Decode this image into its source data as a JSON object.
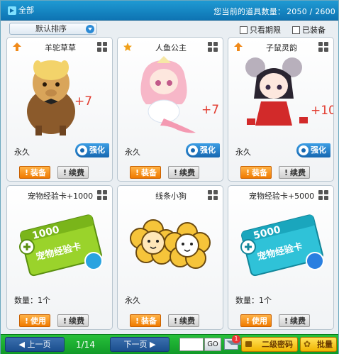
{
  "header": {
    "tab_label": "全部",
    "count_label": "您当前的道具数量：",
    "count_value": "2050 / 2600"
  },
  "filters": {
    "sort_selected": "默认排序",
    "only_expiring": "只看期限",
    "equipped": "已装备"
  },
  "items": [
    {
      "name": "羊驼草草",
      "plus": "+7",
      "duration": "永久",
      "enhance_label": "强化",
      "primary": "装备",
      "secondary": "续费",
      "corner": "up-arrow-icon"
    },
    {
      "name": "人鱼公主",
      "plus": "+7",
      "duration": "永久",
      "enhance_label": "强化",
      "primary": "装备",
      "secondary": "续费",
      "corner": "star-icon"
    },
    {
      "name": "子鼠灵韵",
      "plus": "+10",
      "duration": "永久",
      "enhance_label": "强化",
      "primary": "装备",
      "secondary": "续费",
      "corner": "up-arrow-icon"
    },
    {
      "name": "宠物经验卡+1000",
      "duration": "数量：1个",
      "primary": "使用",
      "secondary": "续费"
    },
    {
      "name": "线条小狗",
      "duration": "永久",
      "primary": "装备",
      "secondary": "续费"
    },
    {
      "name": "宠物经验卡+5000",
      "duration": "数量：1个",
      "primary": "使用",
      "secondary": "续费"
    }
  ],
  "card_art": {
    "exp_1000": "1000",
    "exp_5000": "5000",
    "exp_card_text": "宠物经验卡"
  },
  "footer": {
    "prev_label": "上一页",
    "page_info": "1/14",
    "next_label": "下一页",
    "go_label": "GO",
    "mail_badge": "1",
    "password_label": "二级密码",
    "batch_label": "批量"
  },
  "colors": {
    "header_blue": "#1586c6",
    "footer_green": "#1aad2f",
    "primary_orange": "#f07a00",
    "enhance_blue": "#1667b0"
  }
}
